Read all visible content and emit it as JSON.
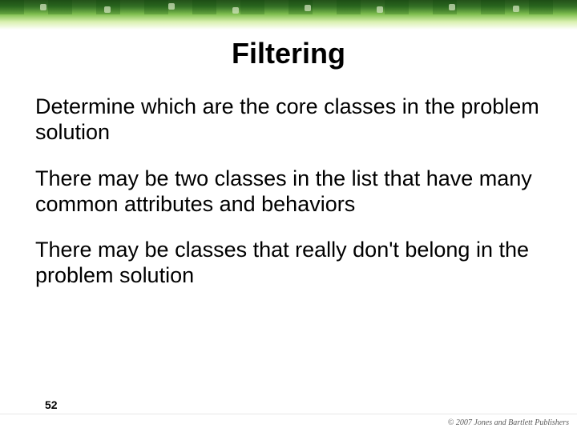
{
  "slide": {
    "title": "Filtering",
    "paragraphs": [
      "Determine which are the core classes in the problem solution",
      "There may be two classes in the list that have many common attributes and behaviors",
      "There may be classes that really don't belong in the problem solution"
    ],
    "page_number": "52",
    "copyright": "© 2007 Jones and Bartlett Publishers"
  }
}
